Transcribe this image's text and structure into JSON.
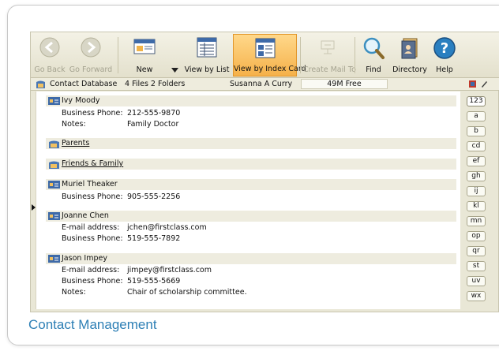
{
  "toolbar": {
    "back": "Go Back",
    "forward": "Go Forward",
    "new": "New",
    "view_list": "View by List",
    "view_card": "View by Index Card",
    "create_mail": "Create Mail To",
    "find": "Find",
    "directory": "Directory",
    "help": "Help"
  },
  "status": {
    "database": "Contact Database",
    "counts": "4 Files  2 Folders",
    "user": "Susanna A Curry",
    "free": "49M Free"
  },
  "entries": {
    "ivy": {
      "name": "Ivy Moody",
      "l1": "Business Phone:",
      "v1": "212-555-9870",
      "l2": "Notes:",
      "v2": "Family Doctor"
    },
    "parents": {
      "name": "Parents"
    },
    "friends": {
      "name": "Friends & Family"
    },
    "muriel": {
      "name": "Muriel Theaker",
      "l1": "Business Phone:",
      "v1": "905-555-2256"
    },
    "joanne": {
      "name": "Joanne Chen",
      "l1": "E-mail address:",
      "v1": "jchen@firstclass.com",
      "l2": "Business Phone:",
      "v2": "519-555-7892"
    },
    "jason": {
      "name": "Jason Impey",
      "l1": "E-mail address:",
      "v1": "jimpey@firstclass.com",
      "l2": "Business Phone:",
      "v2": "519-555-5669",
      "l3": "Notes:",
      "v3": "Chair of scholarship committee."
    }
  },
  "index_tabs": [
    "123",
    "a",
    "b",
    "cd",
    "ef",
    "gh",
    "ij",
    "kl",
    "mn",
    "op",
    "qr",
    "st",
    "uv",
    "wx"
  ],
  "caption": "Contact Management",
  "colors": {
    "active_button": "#f5b14a",
    "caption": "#2d7fb5",
    "app_bg": "#e9e7d6"
  }
}
